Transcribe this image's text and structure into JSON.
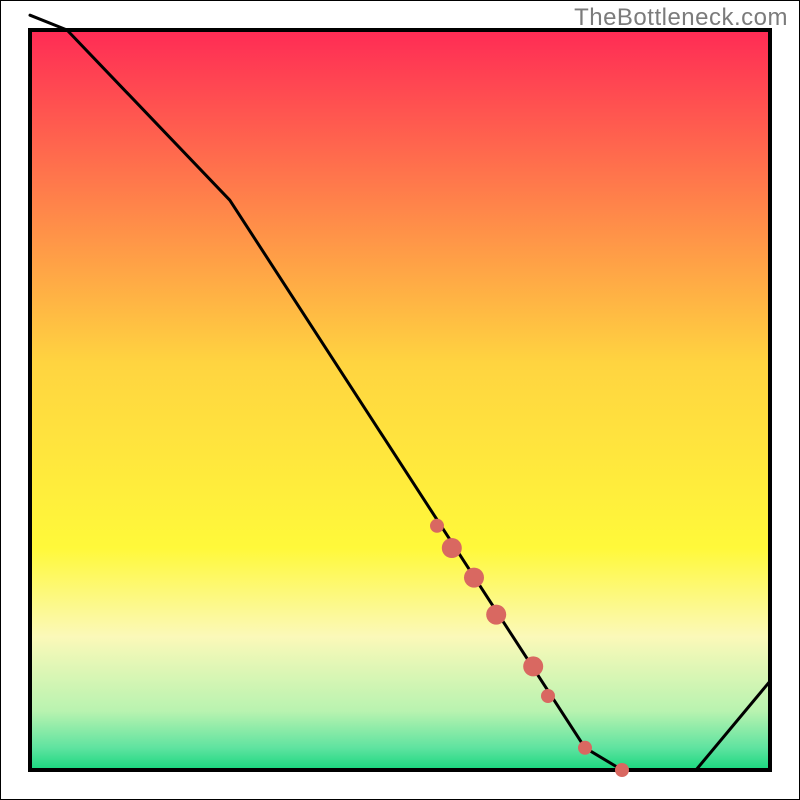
{
  "watermark": "TheBottleneck.com",
  "colors": {
    "border": "#000000",
    "line": "#000000",
    "band_yellow": "#fbf9b9",
    "band_green": "#18d77e",
    "marker": "#d96861"
  },
  "chart_data": {
    "type": "line",
    "title": "",
    "xlabel": "",
    "ylabel": "",
    "xlim": [
      0,
      100
    ],
    "ylim": [
      0,
      100
    ],
    "x": [
      0,
      5,
      27,
      75,
      80,
      90,
      100
    ],
    "values": [
      102,
      100,
      77,
      3,
      0,
      0,
      12
    ],
    "markers_x": [
      55,
      57,
      60,
      63,
      68,
      70,
      75,
      80
    ],
    "markers_values": [
      33,
      30,
      26,
      21,
      14,
      10,
      3,
      0
    ],
    "gradient_stops": [
      {
        "offset": 0.0,
        "color": "#ff2b55"
      },
      {
        "offset": 0.45,
        "color": "#ffd440"
      },
      {
        "offset": 0.7,
        "color": "#fff93a"
      },
      {
        "offset": 0.82,
        "color": "#fbf9b9"
      },
      {
        "offset": 0.92,
        "color": "#b9f3b0"
      },
      {
        "offset": 0.97,
        "color": "#5fe3a0"
      },
      {
        "offset": 1.0,
        "color": "#18d77e"
      }
    ]
  }
}
